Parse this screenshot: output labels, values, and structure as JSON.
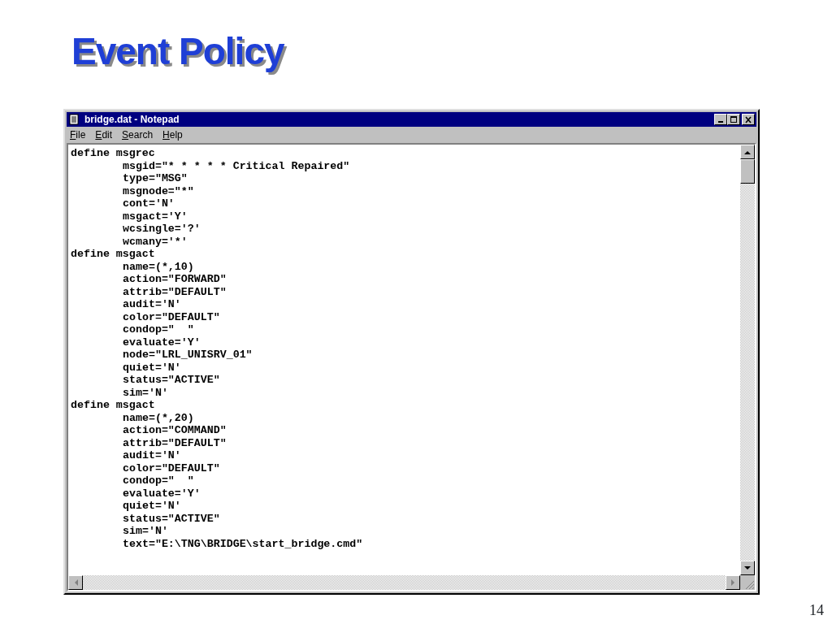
{
  "slide": {
    "title": "Event Policy",
    "page_number": "14"
  },
  "window": {
    "title": "bridge.dat - Notepad"
  },
  "menu": [
    "File",
    "Edit",
    "Search",
    "Help"
  ],
  "document": [
    {
      "header": "define msgrec",
      "children": [
        "msgid=\"* * * * * Critical Repaired\"",
        "type=\"MSG\"",
        "msgnode=\"*\"",
        "cont='N'",
        "msgact='Y'",
        "wcsingle='?'",
        "wcmany='*'"
      ]
    },
    {
      "header": "define msgact",
      "children": [
        "name=(*,10)",
        "action=\"FORWARD\"",
        "attrib=\"DEFAULT\"",
        "audit='N'",
        "color=\"DEFAULT\"",
        "condop=\"  \"",
        "evaluate='Y'",
        "node=\"LRL_UNISRV_01\"",
        "quiet='N'",
        "status=\"ACTIVE\"",
        "sim='N'"
      ]
    },
    {
      "header": "define msgact",
      "children": [
        "name=(*,20)",
        "action=\"COMMAND\"",
        "attrib=\"DEFAULT\"",
        "audit='N'",
        "color=\"DEFAULT\"",
        "condop=\"  \"",
        "evaluate='Y'",
        "quiet='N'",
        "status=\"ACTIVE\"",
        "sim='N'",
        "text=\"E:\\TNG\\BRIDGE\\start_bridge.cmd\""
      ]
    }
  ]
}
